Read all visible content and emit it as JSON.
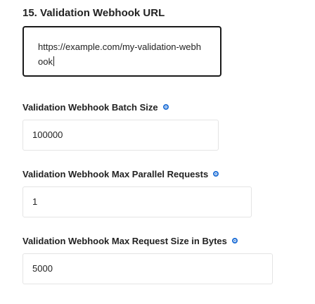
{
  "section": {
    "title": "15. Validation Webhook URL"
  },
  "url_field": {
    "value": "https://example.com/my-validation-webhook"
  },
  "fields": [
    {
      "label": "Validation Webhook Batch Size",
      "value": "100000"
    },
    {
      "label": "Validation Webhook Max Parallel Requests",
      "value": "1"
    },
    {
      "label": "Validation Webhook Max Request Size in Bytes",
      "value": "5000"
    }
  ],
  "icons": {
    "info": "info-icon"
  },
  "colors": {
    "text": "#222222",
    "focus_border": "#1a1a1a",
    "input_border": "#e4e4e4",
    "info_icon": "#1f6fd6"
  }
}
